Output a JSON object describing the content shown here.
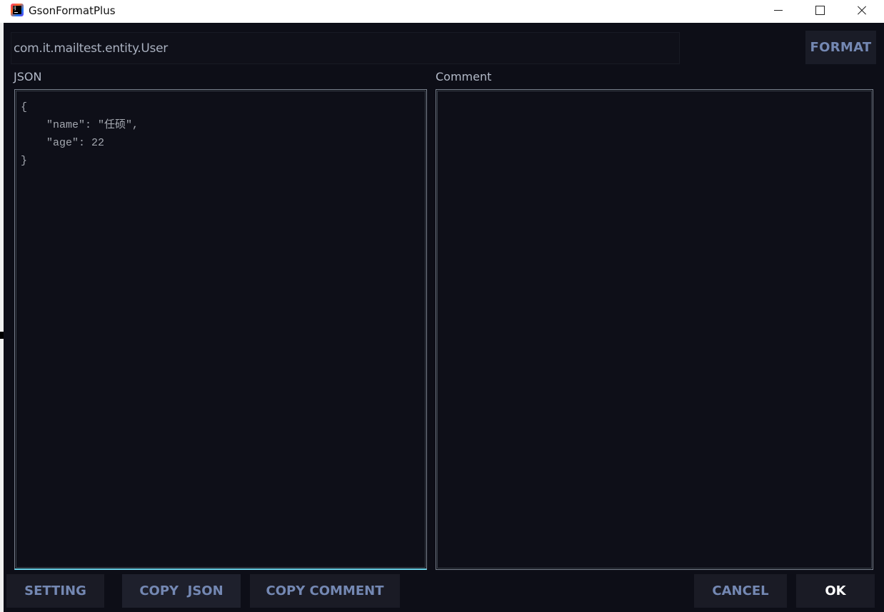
{
  "window": {
    "title": "GsonFormatPlus",
    "app_icon": "intellij-icon",
    "controls": [
      "minimize",
      "maximize",
      "close"
    ]
  },
  "class_field": {
    "value": "com.it.mailtest.entity.User"
  },
  "toolbar": {
    "format_label": "FORMAT"
  },
  "json_panel": {
    "label": "JSON",
    "lines": [
      "{",
      "    \"name\": \"任硕\",",
      "    \"age\": 22",
      "}"
    ]
  },
  "comment_panel": {
    "label": "Comment",
    "content": ""
  },
  "buttons": {
    "setting": "SETTING",
    "copy_json": "COPY  JSON",
    "copy_comment": "COPY COMMENT",
    "cancel": "CANCEL",
    "ok": "OK"
  },
  "colors": {
    "background": "#0d0e17",
    "button_text": "#7488b3",
    "focus_border": "#6ad3e8"
  }
}
